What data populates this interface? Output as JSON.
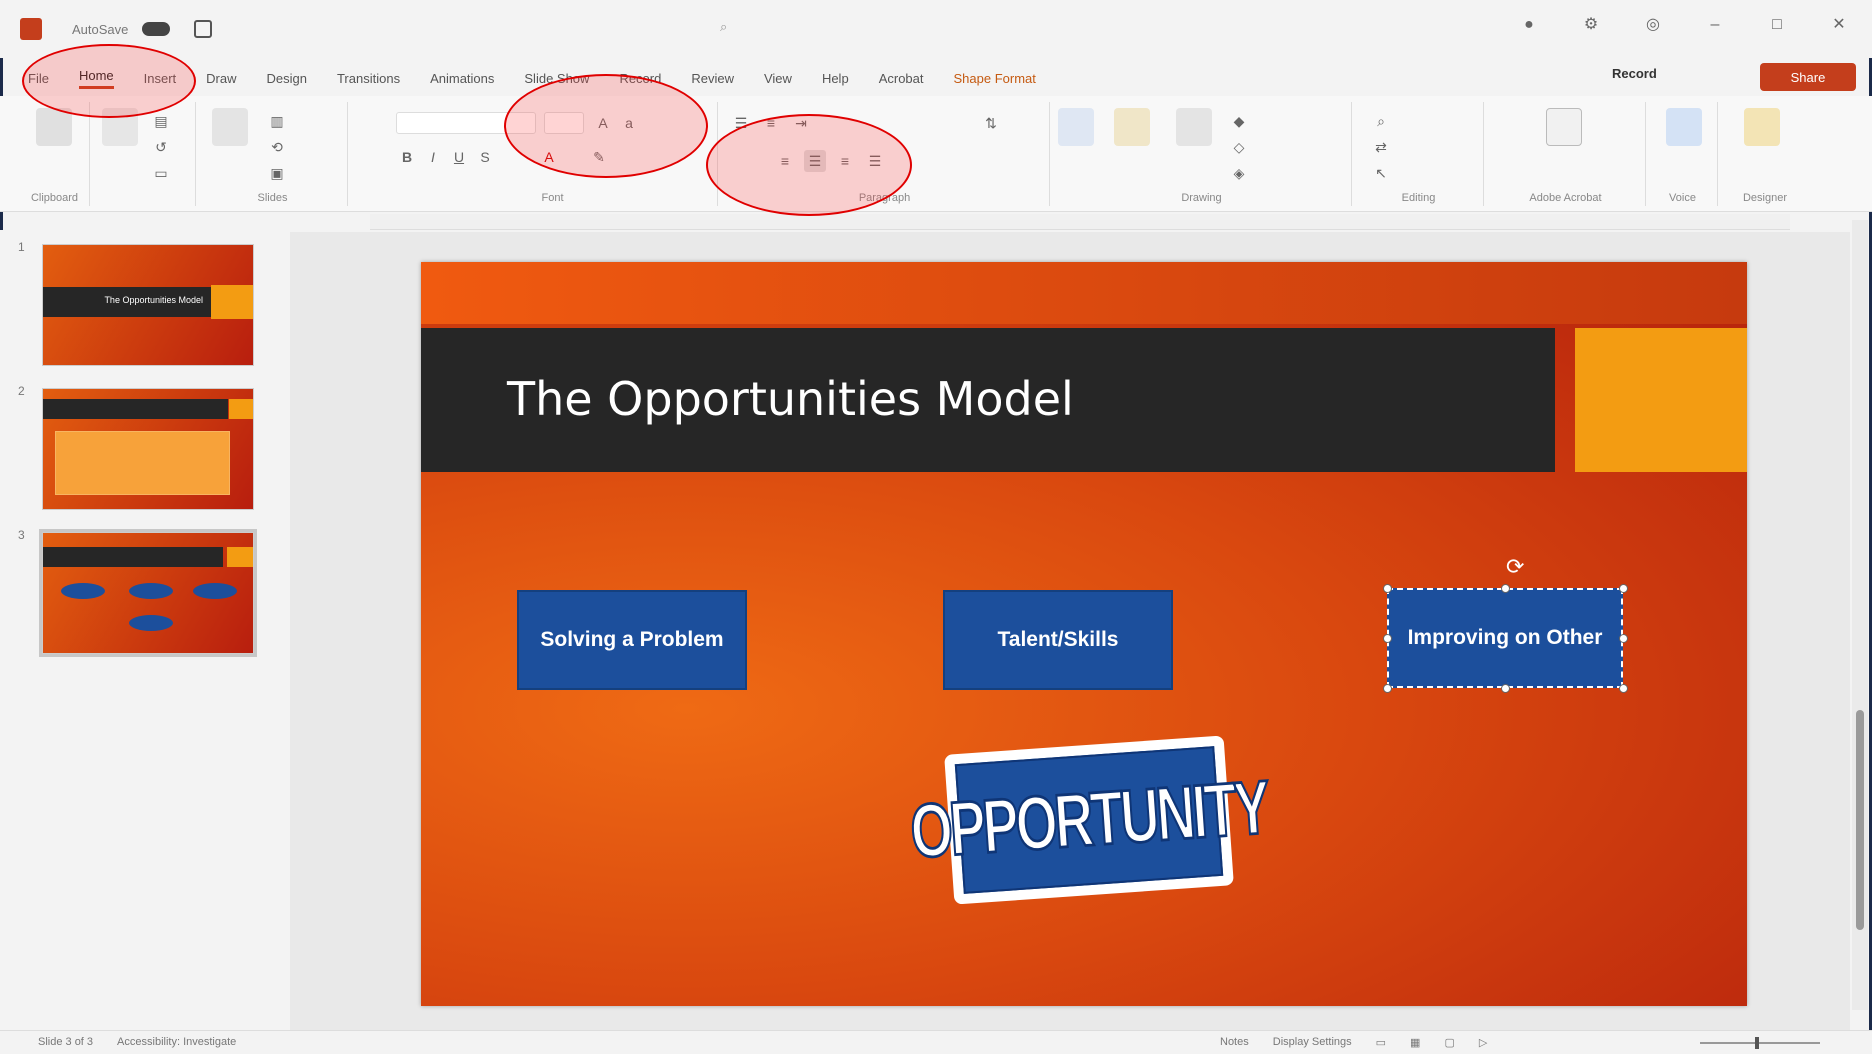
{
  "titlebar": {
    "autosave_label": "AutoSave",
    "doc_title": "",
    "search_placeholder": "",
    "user_name": ""
  },
  "tabs": [
    {
      "label": "File"
    },
    {
      "label": "Home"
    },
    {
      "label": "Insert"
    },
    {
      "label": "Draw"
    },
    {
      "label": "Design"
    },
    {
      "label": "Transitions"
    },
    {
      "label": "Animations"
    },
    {
      "label": "Slide Show"
    },
    {
      "label": "Record"
    },
    {
      "label": "Review"
    },
    {
      "label": "View"
    },
    {
      "label": "Help"
    },
    {
      "label": "Acrobat"
    },
    {
      "label": "Shape Format"
    }
  ],
  "ribbon": {
    "record_label": "Record",
    "share_label": "Share",
    "groups": [
      "Clipboard",
      "Slides",
      "Font",
      "Paragraph",
      "Drawing",
      "Editing",
      "Adobe Acrobat",
      "Voice",
      "Designer"
    ]
  },
  "slides": [
    {
      "number": "1",
      "title": "The Opportunities Model"
    },
    {
      "number": "2",
      "title": ""
    },
    {
      "number": "3",
      "title": "The Opportunities Model"
    }
  ],
  "slide": {
    "title": "The Opportunities Model",
    "boxes": [
      "Solving a Problem",
      "Talent/Skills",
      "Improving on Other"
    ],
    "image_text": "OPPORTUNITY"
  },
  "status": {
    "slide_count": "Slide 3 of 3",
    "accessibility": "Accessibility: Investigate",
    "notes": "Notes",
    "display_settings": "Display Settings",
    "zoom": ""
  },
  "colors": {
    "accent": "#c43e1c",
    "slide_orange": "#e35e0f",
    "box_blue": "#1c4f9c",
    "title_bar": "#262626",
    "annotation": "#e00000"
  }
}
